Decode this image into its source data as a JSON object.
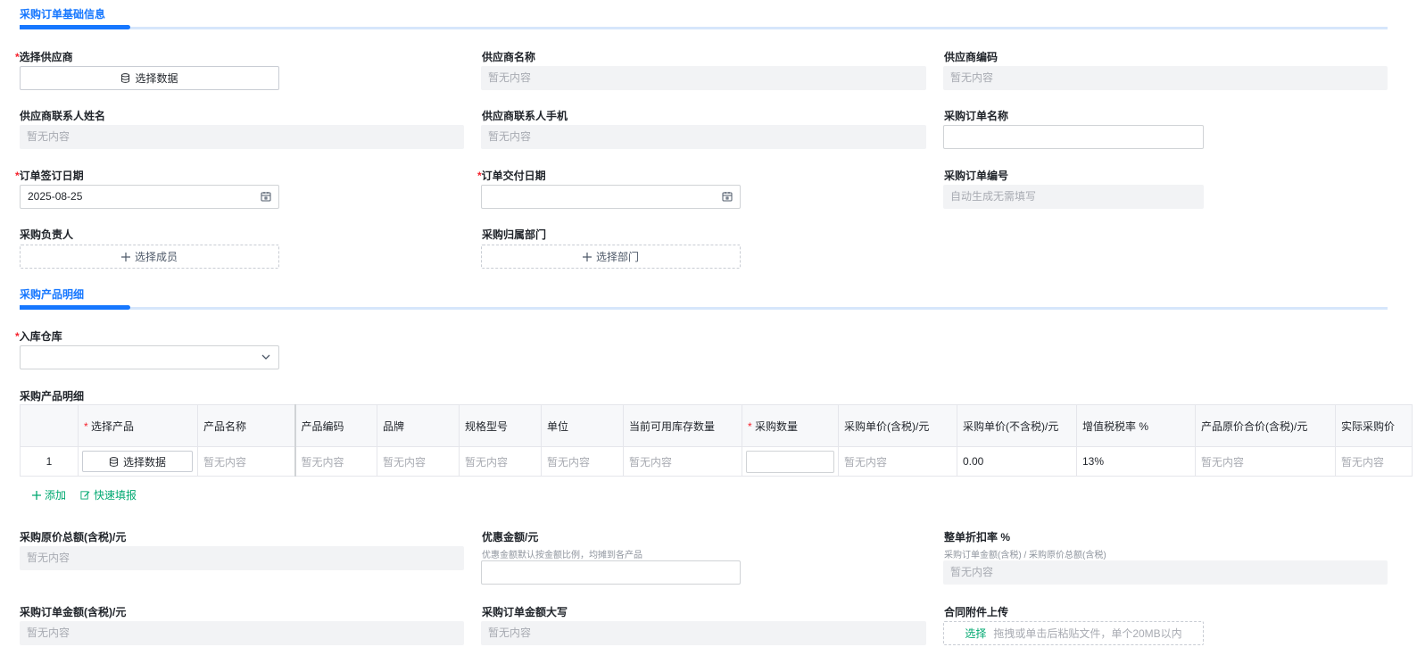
{
  "section1": {
    "title": "采购订单基础信息"
  },
  "section2": {
    "title": "采购产品明细"
  },
  "fields": {
    "supplier_select": {
      "label": "选择供应商",
      "required": "*",
      "button": "选择数据"
    },
    "supplier_name": {
      "label": "供应商名称",
      "value": "暂无内容"
    },
    "supplier_code": {
      "label": "供应商编码",
      "value": "暂无内容"
    },
    "contact_name": {
      "label": "供应商联系人姓名",
      "value": "暂无内容"
    },
    "contact_phone": {
      "label": "供应商联系人手机",
      "value": "暂无内容"
    },
    "order_name": {
      "label": "采购订单名称",
      "value": ""
    },
    "sign_date": {
      "label": "订单签订日期",
      "required": "*",
      "value": "2025-08-25"
    },
    "delivery_date": {
      "label": "订单交付日期",
      "required": "*",
      "value": ""
    },
    "order_no": {
      "label": "采购订单编号",
      "value": "自动生成无需填写"
    },
    "owner": {
      "label": "采购负责人",
      "button": "选择成员"
    },
    "department": {
      "label": "采购归属部门",
      "button": "选择部门"
    },
    "warehouse": {
      "label": "入库仓库",
      "required": "*",
      "value": ""
    },
    "detail_table_label": "采购产品明细",
    "original_total": {
      "label": "采购原价总额(含税)/元",
      "value": "暂无内容"
    },
    "discount": {
      "label": "优惠金额/元",
      "hint": "优惠金额默认按金额比例，均摊到各产品",
      "value": ""
    },
    "discount_rate": {
      "label": "整单折扣率 %",
      "hint": "采购订单金额(含税) / 采购原价总额(含税)",
      "value": "暂无内容"
    },
    "order_amount": {
      "label": "采购订单金额(含税)/元",
      "value": "暂无内容"
    },
    "amount_upper": {
      "label": "采购订单金额大写",
      "value": "暂无内容"
    },
    "attachment": {
      "label": "合同附件上传",
      "select": "选择",
      "hint": "拖拽或单击后粘贴文件，单个20MB以内"
    }
  },
  "table": {
    "headers": {
      "product": "选择产品",
      "product_required": "*",
      "name": "产品名称",
      "code": "产品编码",
      "brand": "品牌",
      "spec": "规格型号",
      "unit": "单位",
      "stock": "当前可用库存数量",
      "qty": "采购数量",
      "qty_required": "*",
      "price_tax": "采购单价(含税)/元",
      "price_notax": "采购单价(不含税)/元",
      "vat": "增值税税率 %",
      "orig_total": "产品原价合价(含税)/元",
      "actual": "实际采购价"
    },
    "row": {
      "index": "1",
      "product_button": "选择数据",
      "name": "暂无内容",
      "code": "暂无内容",
      "brand": "暂无内容",
      "spec": "暂无内容",
      "unit": "暂无内容",
      "stock": "暂无内容",
      "price_tax": "暂无内容",
      "price_notax": "0.00",
      "vat": "13%",
      "orig_total": "暂无内容",
      "actual": "暂无内容"
    }
  },
  "actions": {
    "add": "添加",
    "quick_fill": "快速填报"
  },
  "icons": {
    "data": "database-icon",
    "calendar": "calendar-icon",
    "plus": "plus-icon",
    "chevron": "chevron-down-icon",
    "edit": "edit-icon"
  },
  "colors": {
    "accent": "#1677ff",
    "link": "#00a870",
    "required": "#f5222d"
  }
}
